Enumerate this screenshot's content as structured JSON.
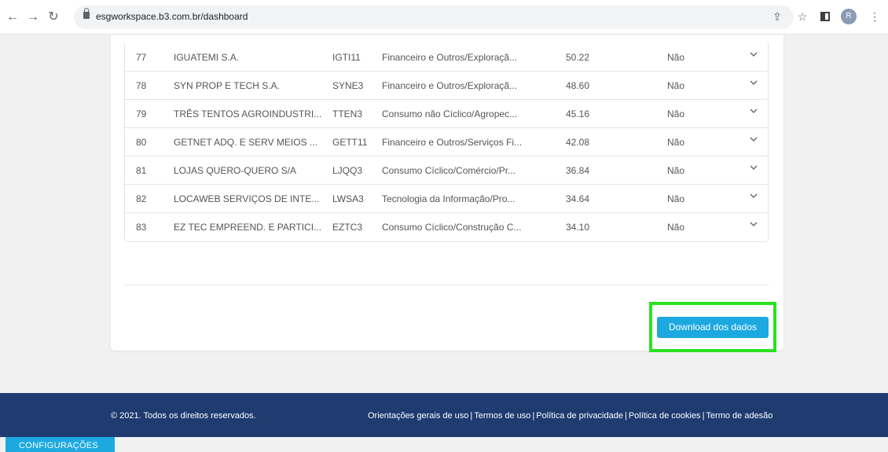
{
  "browser": {
    "url": "esgworkspace.b3.com.br/dashboard",
    "avatar_letter": "R",
    "icons": [
      "back-icon",
      "forward-icon",
      "reload-icon",
      "lock-icon",
      "share-icon",
      "star-icon",
      "sidebar-icon",
      "profile-icon",
      "menu-icon"
    ]
  },
  "table": {
    "rows": [
      {
        "rank": "77",
        "name": "IGUATEMI S.A.",
        "ticker": "IGTI11",
        "sector": "Financeiro e Outros/Exploraçã...",
        "score": "50.22",
        "flag": "Não"
      },
      {
        "rank": "78",
        "name": "SYN PROP E TECH S.A.",
        "ticker": "SYNE3",
        "sector": "Financeiro e Outros/Exploraçã...",
        "score": "48.60",
        "flag": "Não"
      },
      {
        "rank": "79",
        "name": "TRÊS TENTOS AGROINDUSTRI...",
        "ticker": "TTEN3",
        "sector": "Consumo não Cíclico/Agropec...",
        "score": "45.16",
        "flag": "Não"
      },
      {
        "rank": "80",
        "name": "GETNET ADQ. E SERV MEIOS ...",
        "ticker": "GETT11",
        "sector": "Financeiro e Outros/Serviços Fi...",
        "score": "42.08",
        "flag": "Não"
      },
      {
        "rank": "81",
        "name": "LOJAS QUERO-QUERO S/A",
        "ticker": "LJQQ3",
        "sector": "Consumo Cíclico/Comércio/Pr...",
        "score": "36.84",
        "flag": "Não"
      },
      {
        "rank": "82",
        "name": "LOCAWEB SERVIÇOS DE INTE...",
        "ticker": "LWSA3",
        "sector": "Tecnologia da Informação/Pro...",
        "score": "34.64",
        "flag": "Não"
      },
      {
        "rank": "83",
        "name": "EZ TEC EMPREEND. E PARTICI...",
        "ticker": "EZTC3",
        "sector": "Consumo Cíclico/Construção C...",
        "score": "34.10",
        "flag": "Não"
      }
    ]
  },
  "download_label": "Download dos dados",
  "footer": {
    "copyright": "© 2021. Todos os direitos reservados.",
    "links": [
      "Orientações gerais de uso",
      "Termos de uso",
      "Política de privacidade",
      "Política de cookies",
      "Termo de adesão"
    ]
  },
  "config_tab": "CONFIGURAÇÕES",
  "colors": {
    "footer_bg": "#1f3b70",
    "accent": "#1ca9e0",
    "highlight": "#29e31e"
  }
}
